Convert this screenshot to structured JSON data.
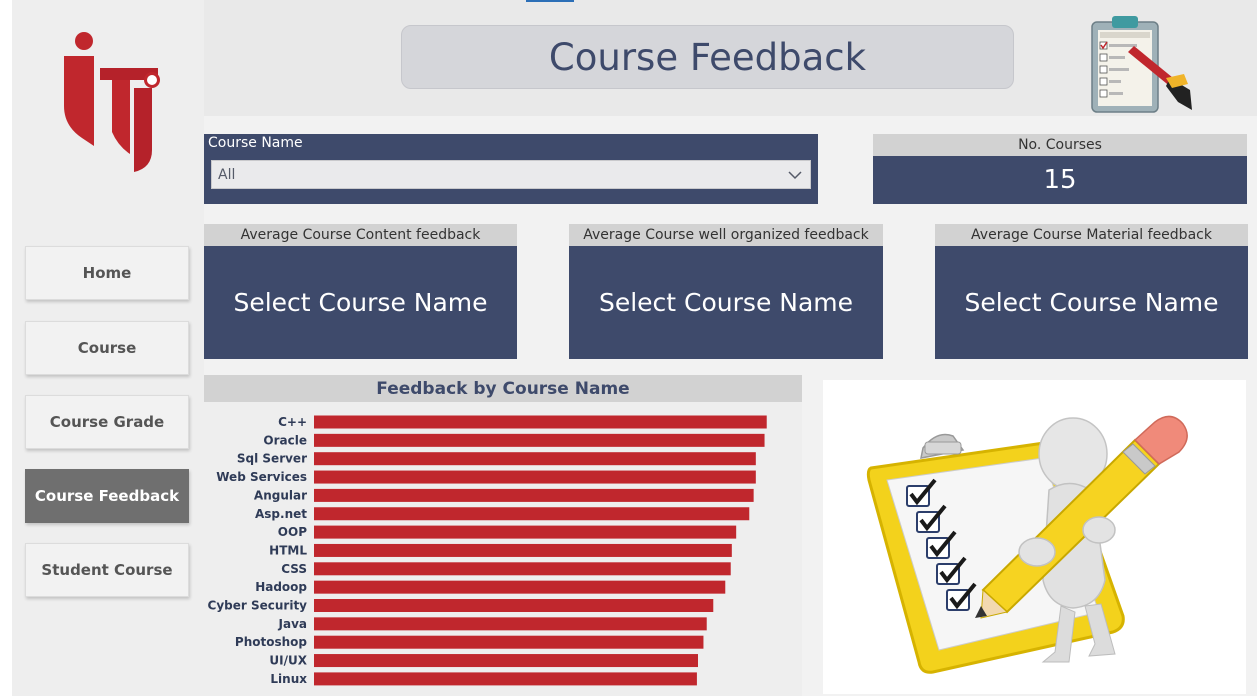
{
  "header": {
    "title": "Course Feedback"
  },
  "sidebar": {
    "logo": "iti-logo",
    "items": [
      {
        "label": "Home",
        "active": false
      },
      {
        "label": "Course",
        "active": false
      },
      {
        "label": "Course Grade",
        "active": false
      },
      {
        "label": "Course Feedback",
        "active": true
      },
      {
        "label": "Student Course",
        "active": false
      }
    ]
  },
  "slicer": {
    "label": "Course Name",
    "value": "All",
    "icon": "chevron-down-icon"
  },
  "cards": {
    "courses": {
      "label": "No. Courses",
      "value": "15"
    },
    "kpis": [
      {
        "label": "Average Course Content feedback",
        "value": "Select Course Name"
      },
      {
        "label": "Average Course well organized feedback",
        "value": "Select Course Name"
      },
      {
        "label": "Average Course Material feedback",
        "value": "Select Course Name"
      }
    ]
  },
  "icons": {
    "header_icon": "satisfaction-clipboard-icon",
    "illustration": "checklist-pencil-illustration"
  },
  "colors": {
    "navy": "#3e4a6b",
    "bar": "#c0272d",
    "active_nav": "#6f6f6f"
  },
  "chart_data": {
    "type": "bar",
    "orientation": "horizontal",
    "title": "Feedback by Course Name",
    "categories": [
      "C++",
      "Oracle",
      "Sql Server",
      "Web Services",
      "Angular",
      "Asp.net",
      "OOP",
      "HTML",
      "CSS",
      "Hadoop",
      "Cyber Security",
      "Java",
      "Photoshop",
      "UI/UX",
      "Linux"
    ],
    "values": [
      4.15,
      4.13,
      4.05,
      4.05,
      4.03,
      3.99,
      3.87,
      3.83,
      3.82,
      3.77,
      3.66,
      3.6,
      3.57,
      3.52,
      3.51
    ],
    "xlim": [
      0,
      4.4
    ],
    "bar_color": "#c0272d",
    "xlabel": "",
    "ylabel": ""
  }
}
